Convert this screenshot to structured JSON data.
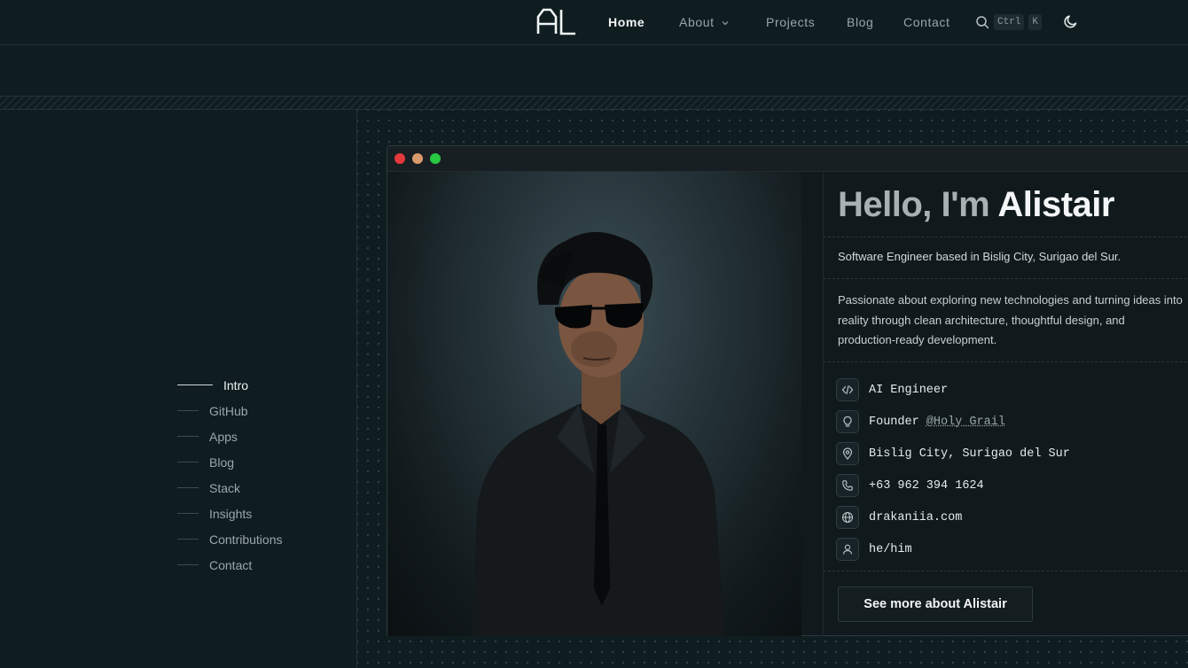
{
  "header": {
    "logo_text": "AL",
    "nav": [
      {
        "label": "Home",
        "active": true
      },
      {
        "label": "About",
        "has_dropdown": true
      },
      {
        "label": "Projects"
      },
      {
        "label": "Blog"
      },
      {
        "label": "Contact"
      }
    ],
    "search_shortcut": [
      "Ctrl",
      "K"
    ]
  },
  "toc": [
    {
      "label": "Intro",
      "active": true
    },
    {
      "label": "GitHub"
    },
    {
      "label": "Apps"
    },
    {
      "label": "Blog"
    },
    {
      "label": "Stack"
    },
    {
      "label": "Insights"
    },
    {
      "label": "Contributions"
    },
    {
      "label": "Contact"
    }
  ],
  "window": {
    "traffic_lights": [
      "#e5383b",
      "#d99a6c",
      "#28c840"
    ]
  },
  "profile": {
    "greeting": "Hello, I'm",
    "name": "Alistair",
    "tagline": "Software Engineer based in Bislig City, Surigao del Sur.",
    "bio_lines": [
      "Passionate about exploring new technologies and turning ideas into",
      "reality through clean architecture, thoughtful design, and",
      "production-ready development."
    ],
    "facts": [
      {
        "icon": "code-icon",
        "text": "AI Engineer"
      },
      {
        "icon": "lightbulb-icon",
        "text": "Founder ",
        "link": "@Holy Grail"
      },
      {
        "icon": "map-pin-icon",
        "text": "Bislig City, Surigao del Sur"
      },
      {
        "icon": "phone-icon",
        "text": "+63 962 394 1624"
      },
      {
        "icon": "globe-icon",
        "text": "drakaniia.com"
      },
      {
        "icon": "user-icon",
        "text": "he/him"
      }
    ],
    "cta": "See more about Alistair"
  },
  "colors": {
    "background": "#0f1d21",
    "text_primary": "#f3f5f6",
    "text_muted": "#9aa6aa"
  }
}
